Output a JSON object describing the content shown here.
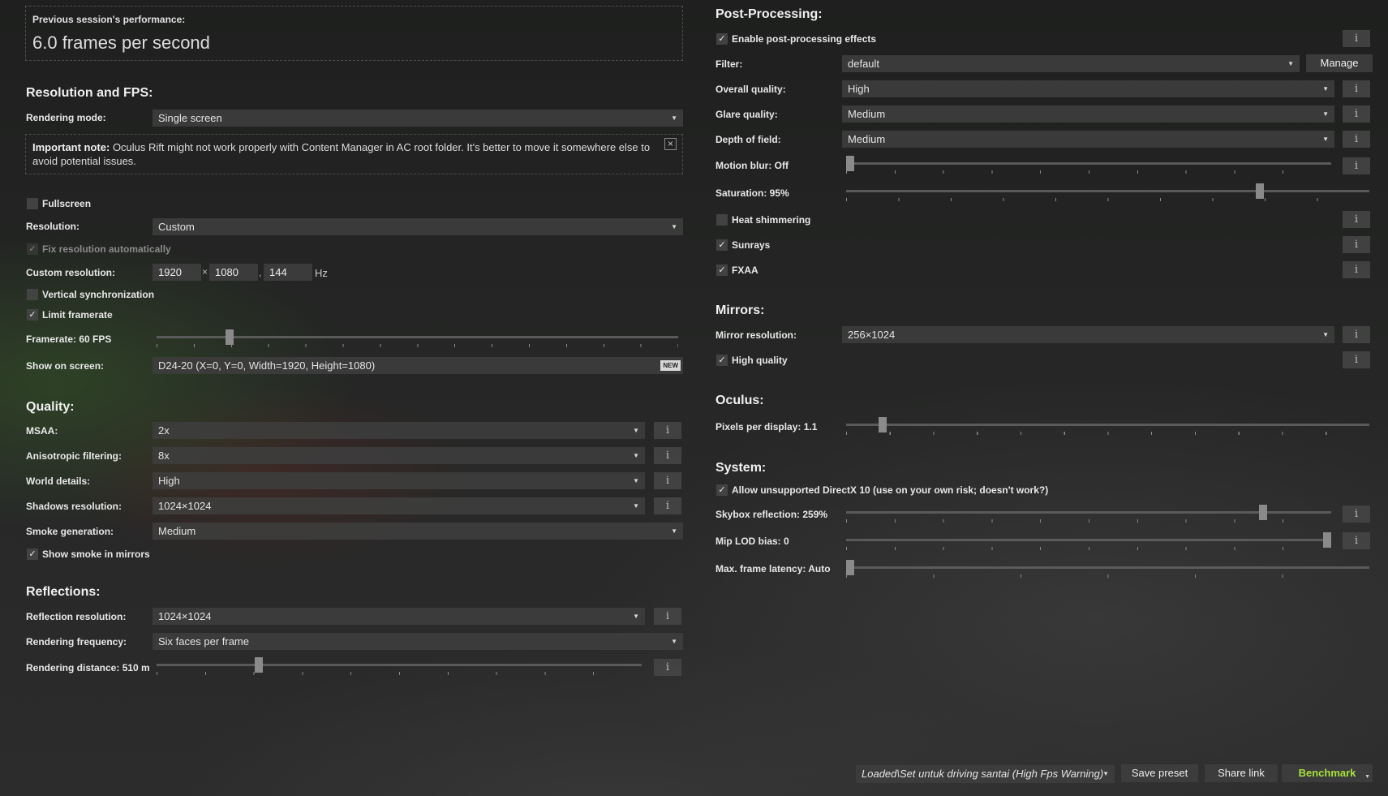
{
  "left": {
    "perf": {
      "title": "Previous session's performance:",
      "value": "6.0 frames per second"
    },
    "res_fps": {
      "heading": "Resolution and FPS:",
      "rendering_mode": {
        "label": "Rendering mode:",
        "value": "Single screen"
      },
      "note": {
        "bold": "Important note:",
        "text": " Oculus Rift might not work properly with Content Manager in AC root folder. It's better to move it somewhere else to avoid potential issues.",
        "close": "×"
      },
      "fullscreen": {
        "label": "Fullscreen",
        "checked": false
      },
      "resolution": {
        "label": "Resolution:",
        "value": "Custom"
      },
      "fix_res": {
        "label": "Fix resolution automatically",
        "checked": true
      },
      "custom_res": {
        "label": "Custom resolution:",
        "width": "1920",
        "times": "×",
        "height": "1080",
        "comma": ",",
        "hz_value": "144",
        "hz": "Hz"
      },
      "vsync": {
        "label": "Vertical synchronization",
        "checked": false
      },
      "limit": {
        "label": "Limit framerate",
        "checked": true
      },
      "framerate": {
        "label": "Framerate: 60 FPS",
        "fraction": 0.14
      },
      "show_on_screen": {
        "label": "Show on screen:",
        "value": "D24-20 (X=0, Y=0, Width=1920, Height=1080)",
        "badge": "NEW"
      }
    },
    "quality": {
      "heading": "Quality:",
      "msaa": {
        "label": "MSAA:",
        "value": "2x"
      },
      "aniso": {
        "label": "Anisotropic filtering:",
        "value": "8x"
      },
      "world": {
        "label": "World details:",
        "value": "High"
      },
      "shadows": {
        "label": "Shadows resolution:",
        "value": "1024×1024"
      },
      "smoke": {
        "label": "Smoke generation:",
        "value": "Medium"
      },
      "smoke_mirrors": {
        "label": "Show smoke in mirrors",
        "checked": true
      }
    },
    "reflections": {
      "heading": "Reflections:",
      "resolution": {
        "label": "Reflection resolution:",
        "value": "1024×1024"
      },
      "frequency": {
        "label": "Rendering frequency:",
        "value": "Six faces per frame"
      },
      "distance": {
        "label": "Rendering distance: 510 m",
        "fraction": 0.21
      }
    }
  },
  "right": {
    "post": {
      "heading": "Post-Processing:",
      "enable": {
        "label": "Enable post-processing effects",
        "checked": true
      },
      "filter": {
        "label": "Filter:",
        "value": "default",
        "manage": "Manage"
      },
      "overall": {
        "label": "Overall quality:",
        "value": "High"
      },
      "glare": {
        "label": "Glare quality:",
        "value": "Medium"
      },
      "dof": {
        "label": "Depth of field:",
        "value": "Medium"
      },
      "motion_blur": {
        "label": "Motion blur: Off",
        "fraction": 0.0
      },
      "saturation": {
        "label": "Saturation: 95%",
        "fraction": 0.79
      },
      "heat": {
        "label": "Heat shimmering",
        "checked": false
      },
      "sunrays": {
        "label": "Sunrays",
        "checked": true
      },
      "fxaa": {
        "label": "FXAA",
        "checked": true
      }
    },
    "mirrors": {
      "heading": "Mirrors:",
      "resolution": {
        "label": "Mirror resolution:",
        "value": "256×1024"
      },
      "hq": {
        "label": "High quality",
        "checked": true
      }
    },
    "oculus": {
      "heading": "Oculus:",
      "ppd": {
        "label": "Pixels per display: 1.1",
        "fraction": 0.07
      }
    },
    "system": {
      "heading": "System:",
      "dx10": {
        "label": "Allow unsupported DirectX 10 (use on your own risk; doesn't work?)",
        "checked": true
      },
      "skybox": {
        "label": "Skybox reflection: 259%",
        "fraction": 0.86
      },
      "mip": {
        "label": "Mip LOD bias: 0",
        "fraction": 1.0
      },
      "latency": {
        "label": "Max. frame latency: Auto",
        "fraction": 0.0
      }
    }
  },
  "footer": {
    "preset": "Loaded\\Set untuk driving santai (High Fps Warning)",
    "save": "Save preset",
    "share": "Share link",
    "benchmark": "Benchmark"
  },
  "icons": {
    "info": "i",
    "check": "✓",
    "arrow": "▼"
  },
  "colors": {
    "accent": "#a6e23a"
  }
}
